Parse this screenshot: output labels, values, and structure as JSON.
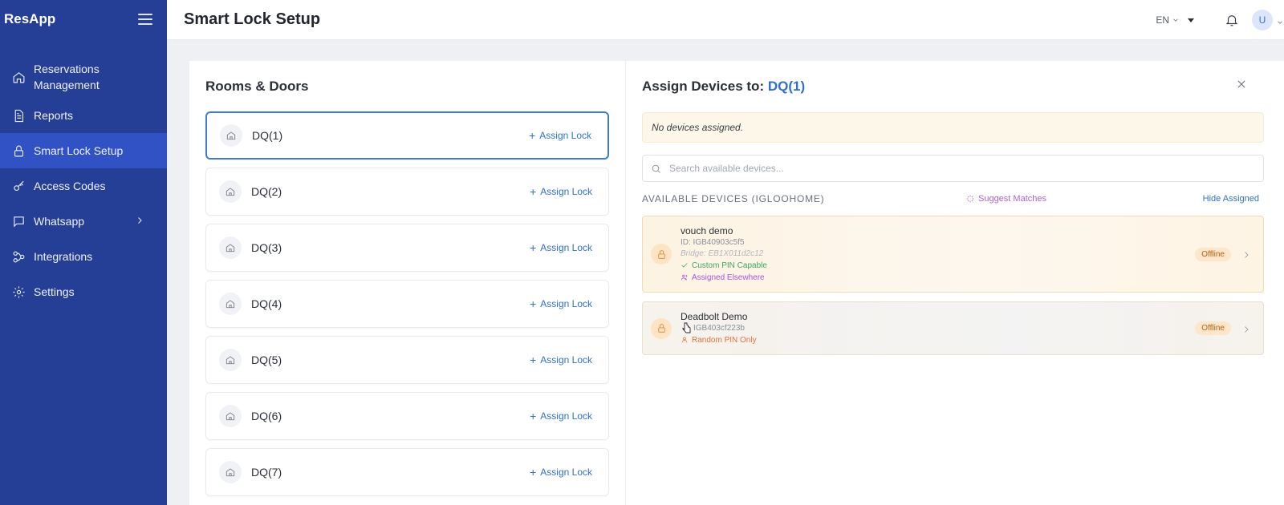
{
  "sidebar": {
    "brand": "ResApp",
    "items": [
      {
        "label": "Reservations Management",
        "icon": "home-icon"
      },
      {
        "label": "Reports",
        "icon": "document-icon"
      },
      {
        "label": "Smart Lock Setup",
        "icon": "lock-icon",
        "active": true
      },
      {
        "label": "Access Codes",
        "icon": "key-icon"
      },
      {
        "label": "Whatsapp",
        "icon": "chat-icon",
        "has_submenu": true
      },
      {
        "label": "Integrations",
        "icon": "integrations-icon"
      },
      {
        "label": "Settings",
        "icon": "gear-icon"
      }
    ]
  },
  "header": {
    "title": "Smart Lock Setup",
    "language": "EN",
    "avatar_initial": "U"
  },
  "rooms_panel": {
    "title": "Rooms & Doors",
    "assign_label": "Assign Lock",
    "rooms": [
      {
        "name": "DQ(1)",
        "selected": true
      },
      {
        "name": "DQ(2)"
      },
      {
        "name": "DQ(3)"
      },
      {
        "name": "DQ(4)"
      },
      {
        "name": "DQ(5)"
      },
      {
        "name": "DQ(6)"
      },
      {
        "name": "DQ(7)"
      }
    ]
  },
  "assign_panel": {
    "title_prefix": "Assign Devices to: ",
    "room": "DQ(1)",
    "notice": "No devices assigned.",
    "search_placeholder": "Search available devices...",
    "available_label": "AVAILABLE DEVICES (IGLOOHOME)",
    "suggest_label": "Suggest Matches",
    "hide_assigned_label": "Hide Assigned",
    "devices": [
      {
        "name": "vouch demo",
        "id": "ID: IGB40903c5f5",
        "bridge": "Bridge: EB1X011d2c12",
        "tags": [
          "Custom PIN Capable",
          "Assigned Elsewhere"
        ],
        "status": "Offline"
      },
      {
        "name": "Deadbolt Demo",
        "id": "IGB403cf223b",
        "tags": [
          "Random PIN Only"
        ],
        "status": "Offline"
      }
    ]
  },
  "colors": {
    "sidebar_bg": "#253f96",
    "sidebar_active": "#3152c4",
    "accent": "#2f6fd0",
    "status_offline": "#b4611b"
  }
}
